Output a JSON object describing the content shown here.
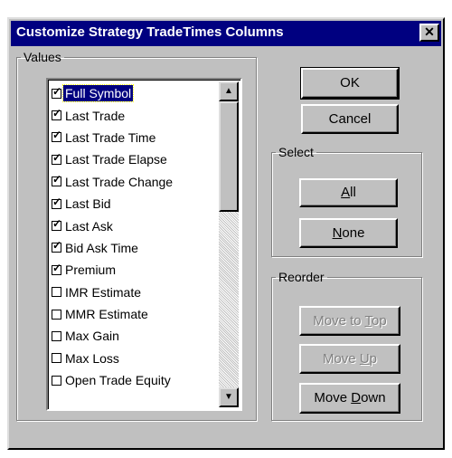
{
  "dialog": {
    "title": "Customize Strategy TradeTimes Columns",
    "close_glyph": "✕",
    "ok_label": "OK",
    "cancel_label": "Cancel"
  },
  "values_group": {
    "label": "Values",
    "items": [
      {
        "label": "Full Symbol",
        "checked": true,
        "selected": true
      },
      {
        "label": "Last Trade",
        "checked": true
      },
      {
        "label": "Last Trade Time",
        "checked": true
      },
      {
        "label": "Last Trade Elapse",
        "checked": true
      },
      {
        "label": "Last Trade Change",
        "checked": true
      },
      {
        "label": "Last Bid",
        "checked": true
      },
      {
        "label": "Last Ask",
        "checked": true
      },
      {
        "label": "Bid Ask Time",
        "checked": true
      },
      {
        "label": "Premium",
        "checked": true
      },
      {
        "label": "IMR Estimate",
        "checked": false
      },
      {
        "label": "MMR Estimate",
        "checked": false
      },
      {
        "label": "Max Gain",
        "checked": false
      },
      {
        "label": "Max Loss",
        "checked": false
      },
      {
        "label": "Open Trade Equity",
        "checked": false
      }
    ],
    "scroll_up_glyph": "▲",
    "scroll_down_glyph": "▼"
  },
  "select_group": {
    "label": "Select",
    "all": {
      "mnemonic": "A",
      "rest": "ll"
    },
    "none": {
      "mnemonic": "N",
      "rest": "one"
    }
  },
  "reorder_group": {
    "label": "Reorder",
    "move_top": {
      "pre": "Move to ",
      "mnemonic": "T",
      "rest": "op",
      "enabled": false
    },
    "move_up": {
      "pre": "Move ",
      "mnemonic": "U",
      "rest": "p",
      "enabled": false
    },
    "move_down": {
      "pre": "Move ",
      "mnemonic": "D",
      "rest": "own",
      "enabled": true
    }
  }
}
